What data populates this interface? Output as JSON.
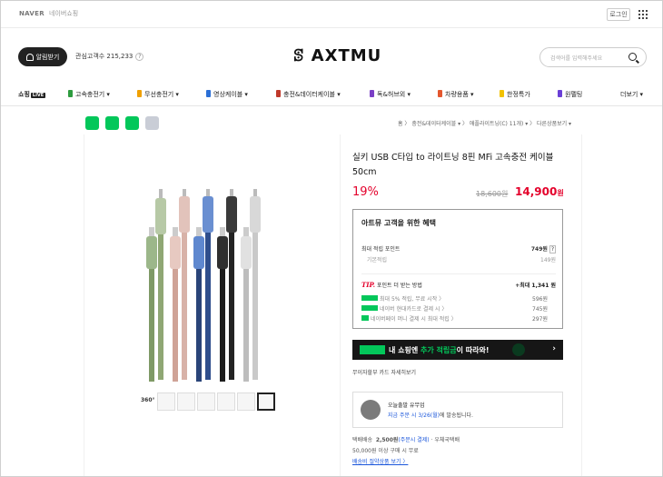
{
  "topbar": {
    "brand": "NAVER",
    "pay": "네이버쇼핑",
    "login": "로그인"
  },
  "header": {
    "alarm": "알림받기",
    "interest_label": "관심고객수 215,233",
    "logo": "ꕷ AXTMU",
    "search_placeholder": "검색어를 입력해주세요"
  },
  "categories": [
    {
      "label": "쇼핑",
      "badge": "LIVE"
    },
    {
      "label": "고속충전기 ▾",
      "color": "#2e9c3f"
    },
    {
      "label": "무선충전기 ▾",
      "color": "#f0a000"
    },
    {
      "label": "영상케이블 ▾",
      "color": "#2b6fd6"
    },
    {
      "label": "충전&데이터케이블 ▾",
      "color": "#c0392b"
    },
    {
      "label": "독&허브외 ▾",
      "color": "#7b3fc6"
    },
    {
      "label": "차량용품 ▾",
      "color": "#e4572e"
    },
    {
      "label": "한정특가",
      "color": "#f2c200"
    },
    {
      "label": "원펠팅",
      "color": "#6a3fd6"
    },
    {
      "label": "더보기 ▾"
    }
  ],
  "breadcrumb": "홈  〉 충전&데이터케이블 ▾  〉 애플라이트닝(C) 11개) ▾  〉 다른상품보기 ▾",
  "product": {
    "title": "실키 USB C타입 to 라이트닝 8핀 MFi 고속충전 케이블 50cm",
    "discount": "19%",
    "original_price": "18,600원",
    "price": "14,900",
    "price_unit": "원"
  },
  "benefit": {
    "title": "아트뮤 고객을 위한 혜택",
    "max_points_label": "최대 적립 포인트",
    "max_points_value": "749원",
    "base_label": "기본적립",
    "base_value": "149원",
    "tip_badge": "TIP.",
    "tip_text": "포인트 더 받는 방법",
    "tip_max": "+최대 1,341 원",
    "tip_rows": [
      {
        "text": "최대 5% 적립, 무료 시작 〉",
        "value": "596원"
      },
      {
        "text": "네이버 현대카드로 결제 시 〉",
        "value": "745원"
      },
      {
        "text": "네이버페이 머니 결제 시 최대 적립 〉",
        "value": "297원"
      }
    ]
  },
  "banner": {
    "prefix": "내 쇼핑엔 ",
    "highlight": "추가 적립금",
    "suffix": "이 따라와!",
    "arrow": "›"
  },
  "installment": "무이자할부   카드 자세히보기",
  "delivery": {
    "line1": "오늘출발 유무업",
    "line2_blue": "지금 주문 시 3/26(월)",
    "line2_rest": "에 발송됩니다."
  },
  "shipping": {
    "label": "택배배송",
    "fee": "2,500원",
    "fee_note": "(주문시 결제)",
    "carrier": "· 우체국택배",
    "free": "50,000원 이상 구매 시 무료",
    "link": "배송비 절약상품 보기 〉"
  },
  "icon360": "360°"
}
